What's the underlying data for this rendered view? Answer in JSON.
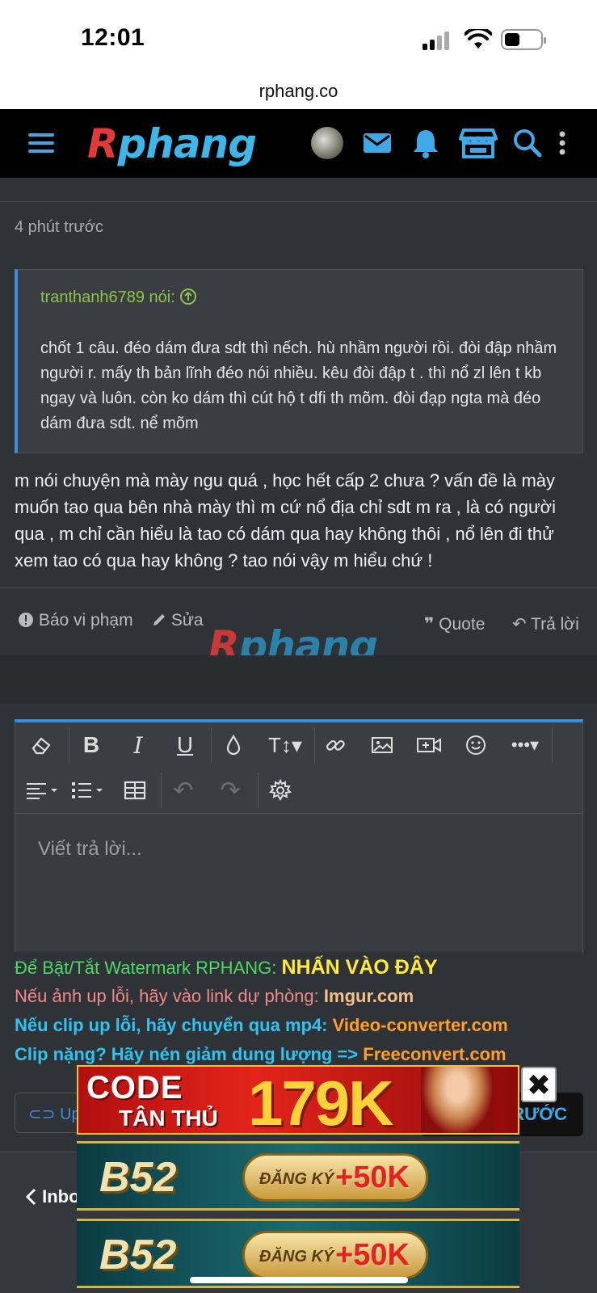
{
  "status_bar": {
    "time": "12:01"
  },
  "browser": {
    "url": "rphang.co"
  },
  "header": {
    "logo_first": "R",
    "logo_rest": "phang",
    "icons": [
      "menu-icon",
      "avatar",
      "mail-icon",
      "bell-icon",
      "store-icon",
      "search-icon",
      "more-icon"
    ]
  },
  "post": {
    "time_ago": "4 phút trước",
    "quote": {
      "author": "tranthanh6789 nói:",
      "author_icon": "arrow-up-circle-icon",
      "text": "chốt 1 câu. đéo dám đưa sdt thì nếch. hù nhầm người rồi. đòi đập nhầm người r. mấy th bản lĩnh đéo nói nhiều. kêu đòi đập t . thì nổ zl lên t kb ngay và luôn. còn ko dám thì cút hộ t dfi th mõm. đòi đạp ngta mà đéo dám đưa sdt. nể mõm"
    },
    "message": "m nói chuyện mà mày ngu quá , học hết cấp 2 chưa ? vấn đề là mày muốn tao qua bên nhà mày thì m cứ nổ địa chỉ sdt m ra , là có người qua , m chỉ cần hiểu là tao có dám qua hay không thôi , nổ lên đi thử xem tao có qua hay không ? tao nói vậy m hiểu chứ !",
    "actions": {
      "report": "Báo vi phạm",
      "edit": "Sửa",
      "quote": "Quote",
      "reply": "Trả lời"
    },
    "watermark_first": "R",
    "watermark_rest": "phang"
  },
  "editor": {
    "placeholder": "Viết trả lời...",
    "toolbar_row1": [
      "eraser-icon",
      "bold-icon",
      "italic-icon",
      "underline-icon",
      "color-drop-icon",
      "text-size-icon",
      "link-icon",
      "image-icon",
      "video-icon",
      "emoji-icon",
      "more-icon"
    ],
    "toolbar_row2": [
      "align-icon",
      "list-icon",
      "table-icon",
      "undo-icon",
      "redo-icon",
      "settings-icon"
    ]
  },
  "notes": {
    "watermark_label": "Để Bật/Tắt Watermark RPHANG:",
    "watermark_link": "NHẤN VÀO ĐÂY",
    "image_label": "Nếu ảnh up lỗi, hãy vào link dự phòng:",
    "image_link": "Imgur.com",
    "clip_label": "Nếu clip up lỗi, hãy chuyển qua mp4:",
    "clip_link": "Video-converter.com",
    "heavy_label": "Clip nặng? Hãy nén giảm dung lượng =>",
    "heavy_link": "Freeconvert.com"
  },
  "buttons": {
    "upload": "Up ả",
    "prev": "RƯỚC"
  },
  "bottom_nav": {
    "inbox": "Inbo"
  },
  "ads": {
    "ad1": {
      "line1": "CODE",
      "line2": "TÂN THỦ",
      "amount": "179K"
    },
    "ad2": {
      "brand": "B52",
      "label": "ĐĂNG KÝ",
      "bonus": "+50K"
    },
    "ad3": {
      "brand": "B52",
      "label": "ĐĂNG KÝ",
      "bonus": "+50K"
    },
    "close": "✖"
  },
  "colors": {
    "accent": "#3f8de0",
    "background": "#2f3237",
    "quote_author": "#8cc34a",
    "note_green": "#4cd964",
    "note_yellow": "#ffeb3b",
    "note_cyan": "#2fc4f0",
    "note_orange": "#ff9f2a"
  }
}
